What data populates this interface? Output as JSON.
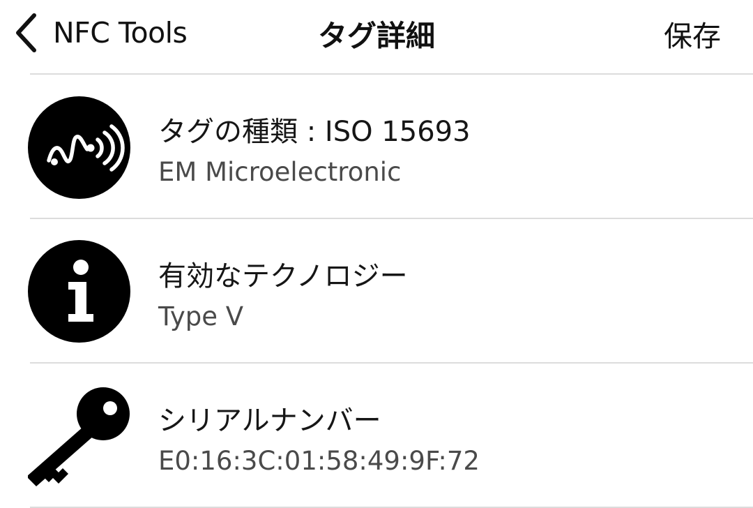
{
  "nav": {
    "back_label": "NFC Tools",
    "title": "タグ詳細",
    "save_label": "保存"
  },
  "rows": [
    {
      "icon": "nfc-wave-icon",
      "title": "タグの種類 : ISO 15693",
      "value": "EM Microelectronic"
    },
    {
      "icon": "info-icon",
      "title": "有効なテクノロジー",
      "value": "Type V"
    },
    {
      "icon": "key-icon",
      "title": "シリアルナンバー",
      "value": "E0:16:3C:01:58:49:9F:72"
    }
  ],
  "colors": {
    "icon": "#000000",
    "separator": "#dcdcdc",
    "subtitle": "#4a4a4a"
  }
}
